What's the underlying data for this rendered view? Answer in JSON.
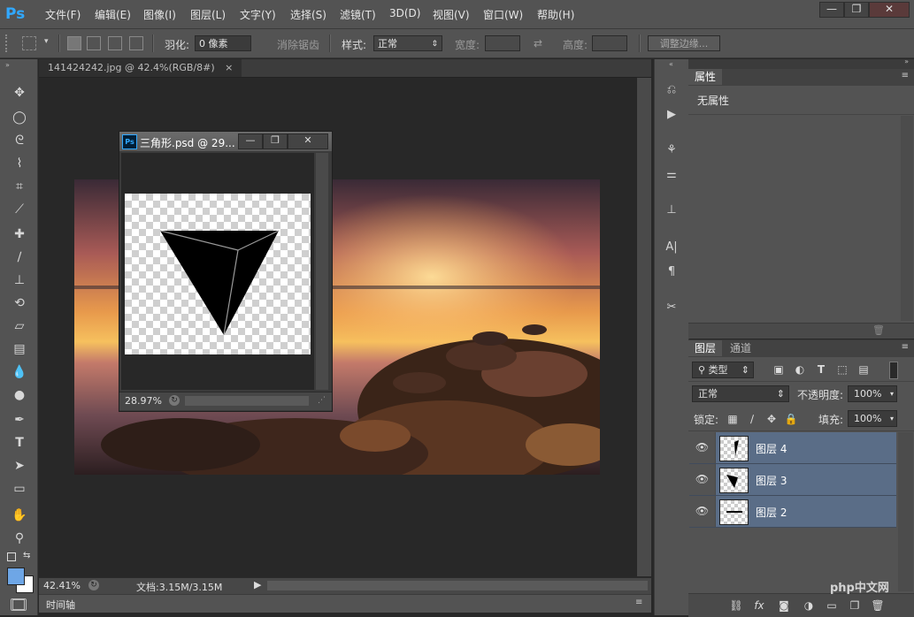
{
  "app": {
    "logo": "Ps"
  },
  "menu": [
    "文件(F)",
    "编辑(E)",
    "图像(I)",
    "图层(L)",
    "文字(Y)",
    "选择(S)",
    "滤镜(T)",
    "3D(D)",
    "视图(V)",
    "窗口(W)",
    "帮助(H)"
  ],
  "window_controls": {
    "minimize": "—",
    "restore": "❐",
    "close": "✕"
  },
  "options": {
    "feather_label": "羽化:",
    "feather_value": "0 像素",
    "antialias_label": "消除锯齿",
    "style_label": "样式:",
    "style_value": "正常",
    "width_label": "宽度:",
    "height_label": "高度:",
    "refine_edge": "调整边缘..."
  },
  "document": {
    "tab_title": "141424242.jpg @ 42.4%(RGB/8#)",
    "tab_close": "×",
    "zoom": "42.41%",
    "doc_info": "文档:3.15M/3.15M"
  },
  "floating_document": {
    "title": "三角形.psd @ 29...",
    "zoom": "28.97%"
  },
  "timeline": {
    "label": "时间轴"
  },
  "properties_panel": {
    "tab": "属性",
    "empty_text": "无属性"
  },
  "layers_panel": {
    "tabs": [
      "图层",
      "通道"
    ],
    "filter_kind": "类型",
    "blend_mode": "正常",
    "opacity_label": "不透明度:",
    "opacity_value": "100%",
    "lock_label": "锁定:",
    "fill_label": "填充:",
    "fill_value": "100%",
    "layers": [
      {
        "name": "图层 4"
      },
      {
        "name": "图层 3"
      },
      {
        "name": "图层 2"
      }
    ]
  },
  "colors": {
    "foreground": "#6ea6e6",
    "background": "#ffffff",
    "selected_layer": "#5a6d87"
  },
  "watermark": {
    "text": "php中文网"
  }
}
